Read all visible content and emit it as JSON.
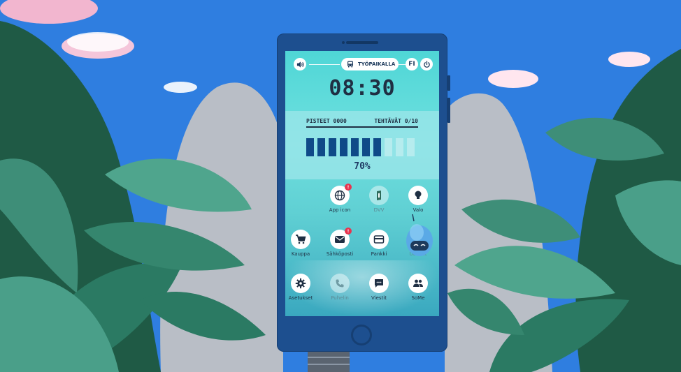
{
  "status_bar": {
    "sound_icon": "speaker-icon",
    "location_label": "TYÖPAIKALLA",
    "location_icon": "bus-icon",
    "language_label": "FI",
    "power_icon": "power-icon"
  },
  "clock": {
    "time": "08:30"
  },
  "scores": {
    "points_label": "PISTEET",
    "points_value": "0000",
    "tasks_label": "TEHTÄVÄT",
    "tasks_value": "0/10"
  },
  "battery": {
    "percent_text": "70%",
    "level": 0.7,
    "segments_total": 10,
    "fill_color": "#0f4a88",
    "empty_color": "#b6ecee"
  },
  "apps": [
    {
      "id": "app-icon",
      "label": "App icon",
      "icon": "globe-icon",
      "badge": "!",
      "active": true
    },
    {
      "id": "dvv",
      "label": "DVV",
      "icon": "dvv-logo-icon",
      "badge": "",
      "active": false
    },
    {
      "id": "valo",
      "label": "Valo",
      "icon": "lightbulb-icon",
      "badge": "",
      "active": true
    },
    {
      "id": "kauppa",
      "label": "Kauppa",
      "icon": "cart-icon",
      "badge": "",
      "active": true
    },
    {
      "id": "sahkoposti",
      "label": "Sähköposti",
      "icon": "mail-icon",
      "badge": "!",
      "active": true
    },
    {
      "id": "pankki",
      "label": "Pankki",
      "icon": "card-icon",
      "badge": "",
      "active": true
    },
    {
      "id": "uutiset",
      "label": "Uutiset",
      "icon": "rss-icon",
      "badge": "",
      "active": false
    },
    {
      "id": "asetukset",
      "label": "Asetukset",
      "icon": "gear-icon",
      "badge": "",
      "active": true
    },
    {
      "id": "puhelin",
      "label": "Puhelin",
      "icon": "phone-icon",
      "badge": "",
      "active": false
    },
    {
      "id": "viestit",
      "label": "Viestit",
      "icon": "chat-icon",
      "badge": "",
      "active": true
    },
    {
      "id": "some",
      "label": "SoMe",
      "icon": "people-icon",
      "badge": "",
      "active": true
    }
  ],
  "colors": {
    "sky": "#2f7ee0",
    "phone_body": "#1d4f8f",
    "screen_top": "#4fd6d6",
    "text_dark": "#1f2f43",
    "badge_red": "#e8344f"
  }
}
